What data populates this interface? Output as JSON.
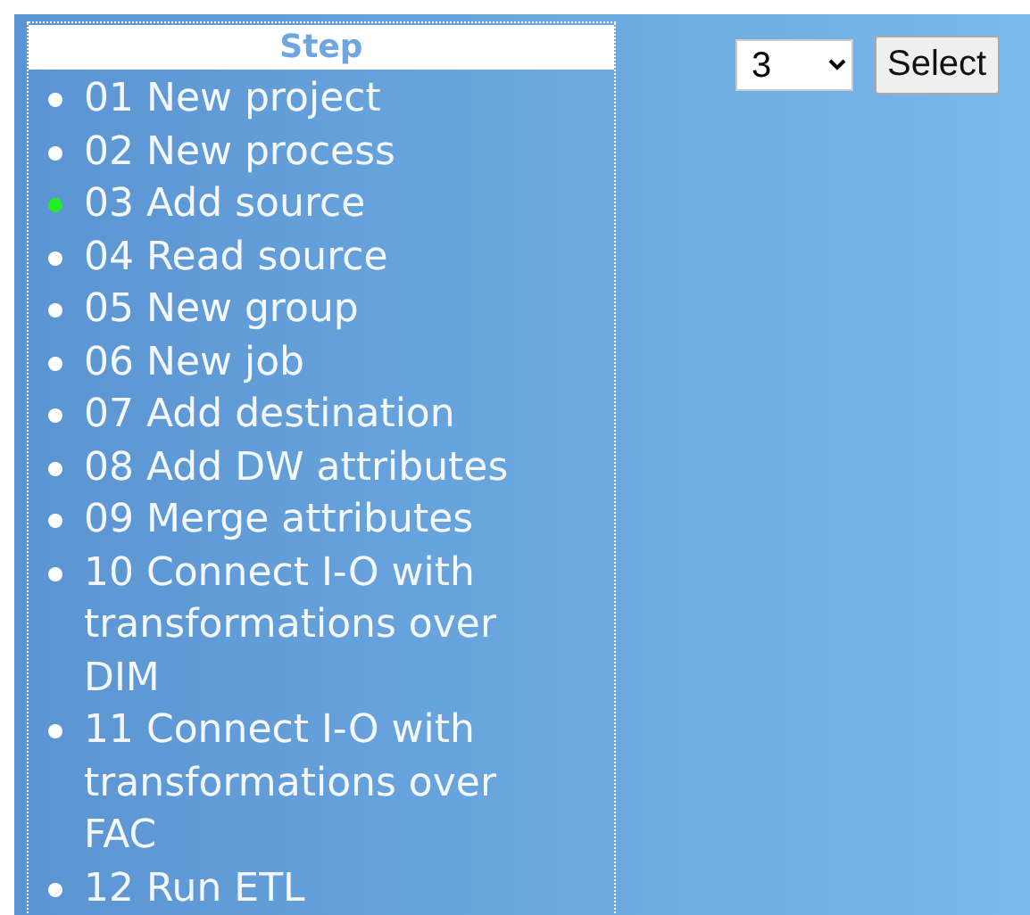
{
  "steps_panel": {
    "header": "Step",
    "items": [
      {
        "label": "01 New project",
        "selected": false
      },
      {
        "label": "02 New process",
        "selected": false
      },
      {
        "label": "03 Add source",
        "selected": true
      },
      {
        "label": "04 Read source",
        "selected": false
      },
      {
        "label": "05 New group",
        "selected": false
      },
      {
        "label": "06 New job",
        "selected": false
      },
      {
        "label": "07 Add destination",
        "selected": false
      },
      {
        "label": "08 Add DW attributes",
        "selected": false
      },
      {
        "label": "09 Merge attributes",
        "selected": false
      },
      {
        "label": "10 Connect I-O with transformations over DIM",
        "selected": false
      },
      {
        "label": "11 Connect I-O with transformations over FAC",
        "selected": false
      },
      {
        "label": "12 Run ETL",
        "selected": false
      }
    ]
  },
  "step_select": {
    "value": "3"
  },
  "select_button": "Select"
}
